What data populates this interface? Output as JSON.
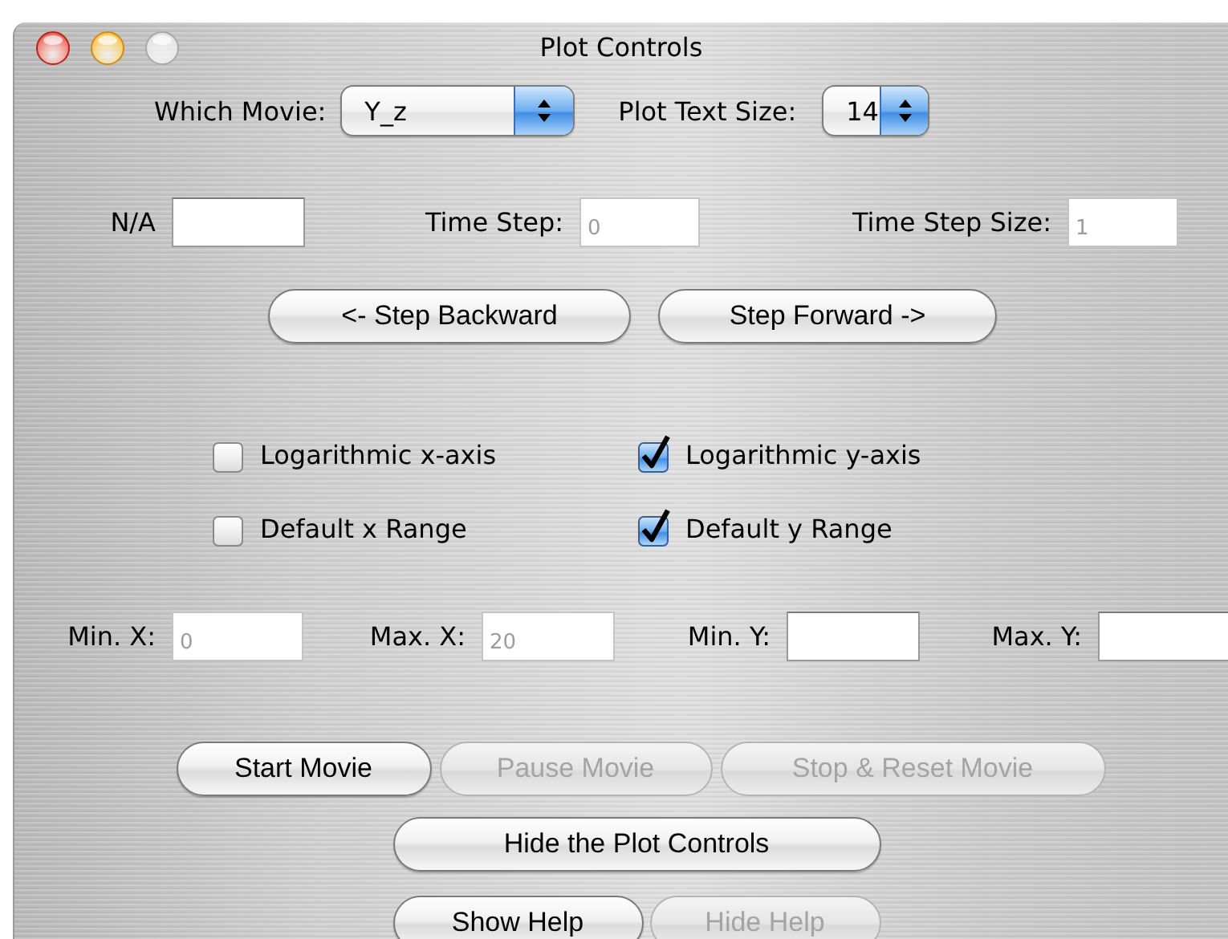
{
  "window": {
    "title": "Plot Controls"
  },
  "popups": [
    {
      "label": "Which Movie:",
      "value": "Y_z"
    },
    {
      "label": "Plot Text Size:",
      "value": "14"
    }
  ],
  "step_fields": [
    {
      "label": "N/A",
      "disabled": false
    },
    {
      "label": "Time Step:",
      "value": "0",
      "disabled": true
    },
    {
      "label": "Time Step Size:",
      "value": "1",
      "disabled": true
    }
  ],
  "step_buttons": [
    {
      "label": "<- Step Backward",
      "disabled": false
    },
    {
      "label": "Step Forward ->",
      "disabled": false
    }
  ],
  "checkboxes": [
    {
      "label": "Logarithmic x-axis",
      "checked": false
    },
    {
      "label": "Logarithmic y-axis",
      "checked": true
    },
    {
      "label": "Default x Range",
      "checked": false
    },
    {
      "label": "Default y Range",
      "checked": true
    }
  ],
  "range_fields": [
    {
      "label": "Min. X:",
      "value": "0",
      "disabled": true
    },
    {
      "label": "Max. X:",
      "value": "20",
      "disabled": true
    },
    {
      "label": "Min. Y:",
      "disabled": false
    },
    {
      "label": "Max. Y:",
      "disabled": false
    }
  ],
  "movie_buttons": [
    {
      "label": "Start Movie",
      "disabled": false
    },
    {
      "label": "Pause Movie",
      "disabled": true
    },
    {
      "label": "Stop & Reset Movie",
      "disabled": true
    }
  ],
  "hide_button": {
    "label": "Hide the Plot Controls",
    "disabled": false
  },
  "help_buttons": [
    {
      "label": "Show Help",
      "disabled": false
    },
    {
      "label": "Hide Help",
      "disabled": true
    }
  ]
}
